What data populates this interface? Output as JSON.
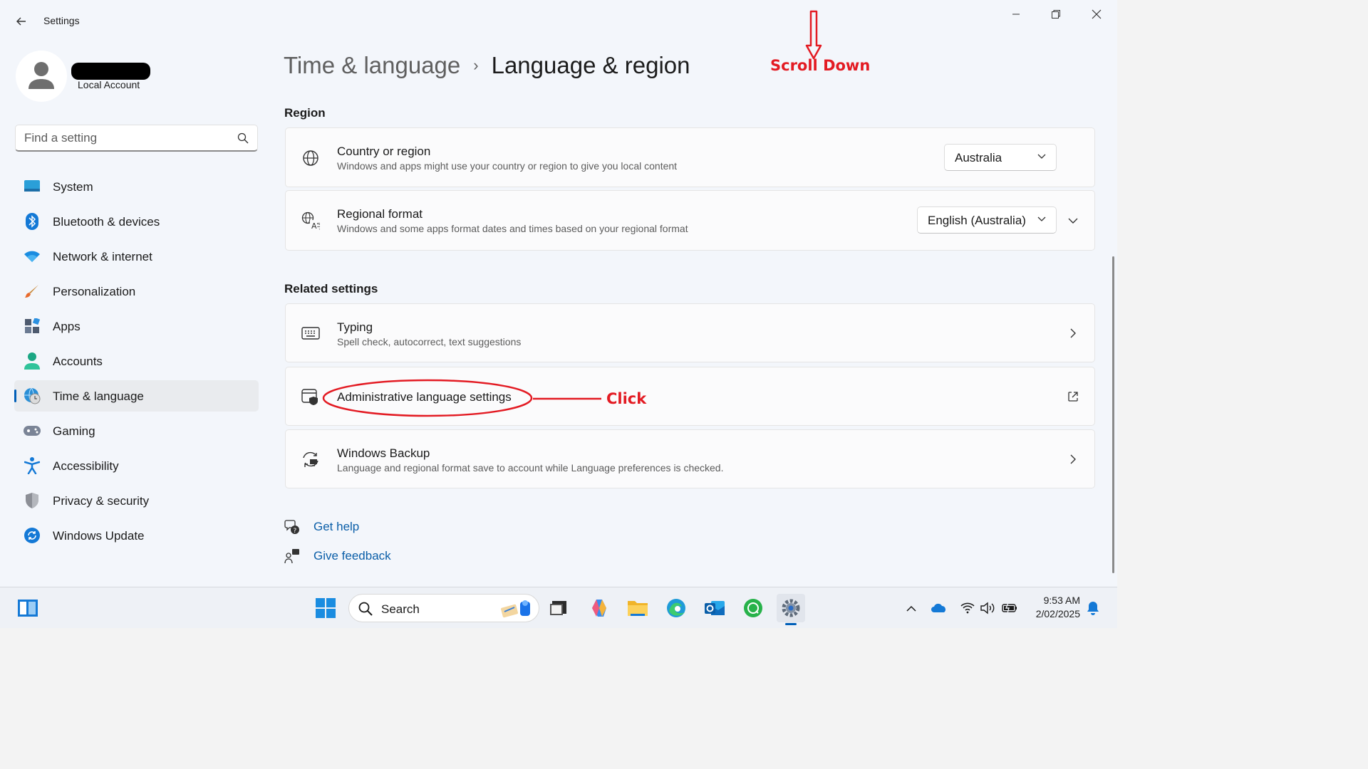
{
  "window": {
    "app_title": "Settings",
    "controls": [
      "minimize",
      "maximize",
      "close"
    ]
  },
  "account": {
    "name_redacted": true,
    "type": "Local Account"
  },
  "search": {
    "placeholder": "Find a setting"
  },
  "sidebar": {
    "items": [
      {
        "label": "System",
        "icon": "monitor-icon",
        "active": false
      },
      {
        "label": "Bluetooth & devices",
        "icon": "bluetooth-icon",
        "active": false
      },
      {
        "label": "Network & internet",
        "icon": "wifi-icon",
        "active": false
      },
      {
        "label": "Personalization",
        "icon": "brush-icon",
        "active": false
      },
      {
        "label": "Apps",
        "icon": "apps-icon",
        "active": false
      },
      {
        "label": "Accounts",
        "icon": "accounts-icon",
        "active": false
      },
      {
        "label": "Time & language",
        "icon": "globe-clock-icon",
        "active": true
      },
      {
        "label": "Gaming",
        "icon": "gamepad-icon",
        "active": false
      },
      {
        "label": "Accessibility",
        "icon": "accessibility-icon",
        "active": false
      },
      {
        "label": "Privacy & security",
        "icon": "shield-icon",
        "active": false
      },
      {
        "label": "Windows Update",
        "icon": "update-icon",
        "active": false
      }
    ]
  },
  "breadcrumb": {
    "parent": "Time & language",
    "separator": "›",
    "current": "Language & region"
  },
  "region": {
    "title": "Region",
    "country": {
      "title": "Country or region",
      "subtitle": "Windows and apps might use your country or region to give you local content",
      "value": "Australia"
    },
    "format": {
      "title": "Regional format",
      "subtitle": "Windows and some apps format dates and times based on your regional format",
      "value": "English (Australia)"
    }
  },
  "related": {
    "title": "Related settings",
    "typing": {
      "title": "Typing",
      "subtitle": "Spell check, autocorrect, text suggestions"
    },
    "admin": {
      "title": "Administrative language settings"
    },
    "backup": {
      "title": "Windows Backup",
      "subtitle": "Language and regional format save to account while Language preferences is checked."
    }
  },
  "help": {
    "get_help": "Get help",
    "give_feedback": "Give feedback"
  },
  "annotations": {
    "scroll": "Scroll Down",
    "click": "Click",
    "color": "#e31b23"
  },
  "taskbar": {
    "search_label": "Search",
    "apps": [
      "start-icon",
      "file-explorer-icon",
      "copilot-icon",
      "folder-icon",
      "edge-icon",
      "outlook-icon",
      "chat-icon",
      "settings-icon"
    ],
    "tray": [
      "chevron-up-icon",
      "onedrive-icon",
      "wifi-icon",
      "volume-icon",
      "battery-icon",
      "notification-bell-icon"
    ],
    "time": "9:53 AM",
    "date": "2/02/2025"
  },
  "colors": {
    "accent": "#005fb8",
    "link": "#0a5ea8",
    "background": "#f3f6fb",
    "card": "#fbfbfc"
  }
}
